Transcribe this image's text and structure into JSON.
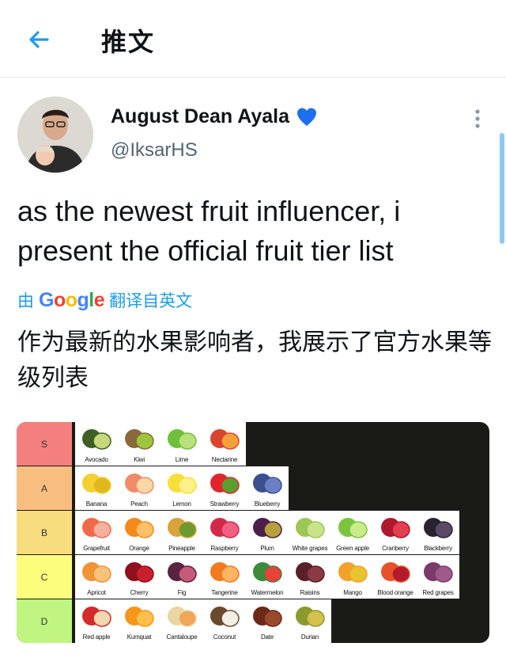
{
  "header": {
    "title": "推文"
  },
  "tweet": {
    "author_name": "August Dean Ayala",
    "handle": "@IksarHS",
    "text": "as the newest fruit influencer, i present the official fruit tier list",
    "translate_prefix": "由",
    "translate_brand": "Google",
    "translate_suffix": "翻译自英文",
    "translated_text": "作为最新的水果影响者，我展示了官方水果等级列表"
  },
  "colors": {
    "accent": "#1d9bf0",
    "S": "#f47f7f",
    "A": "#f8be7f",
    "B": "#f7dd7e",
    "C": "#fdfd7d",
    "D": "#bff580"
  },
  "tiers": [
    {
      "label": "S",
      "items": [
        "Avocado",
        "Kiwi",
        "Lime",
        "Nectarine"
      ]
    },
    {
      "label": "A",
      "items": [
        "Banana",
        "Peach",
        "Lemon",
        "Strawberry",
        "Blueberry"
      ]
    },
    {
      "label": "B",
      "items": [
        "Grapefruit",
        "Orange",
        "Pineapple",
        "Raspberry",
        "Plum",
        "White grapes",
        "Green apple",
        "Cranberry",
        "Blackberry"
      ]
    },
    {
      "label": "C",
      "items": [
        "Apricot",
        "Cherry",
        "Fig",
        "Tangerine",
        "Watermelon",
        "Raisins",
        "Mango",
        "Blood orange",
        "Red grapes"
      ]
    },
    {
      "label": "D",
      "items": [
        "Red apple",
        "Kumquat",
        "Cantaloupe",
        "Coconut",
        "Date",
        "Durian"
      ]
    }
  ]
}
